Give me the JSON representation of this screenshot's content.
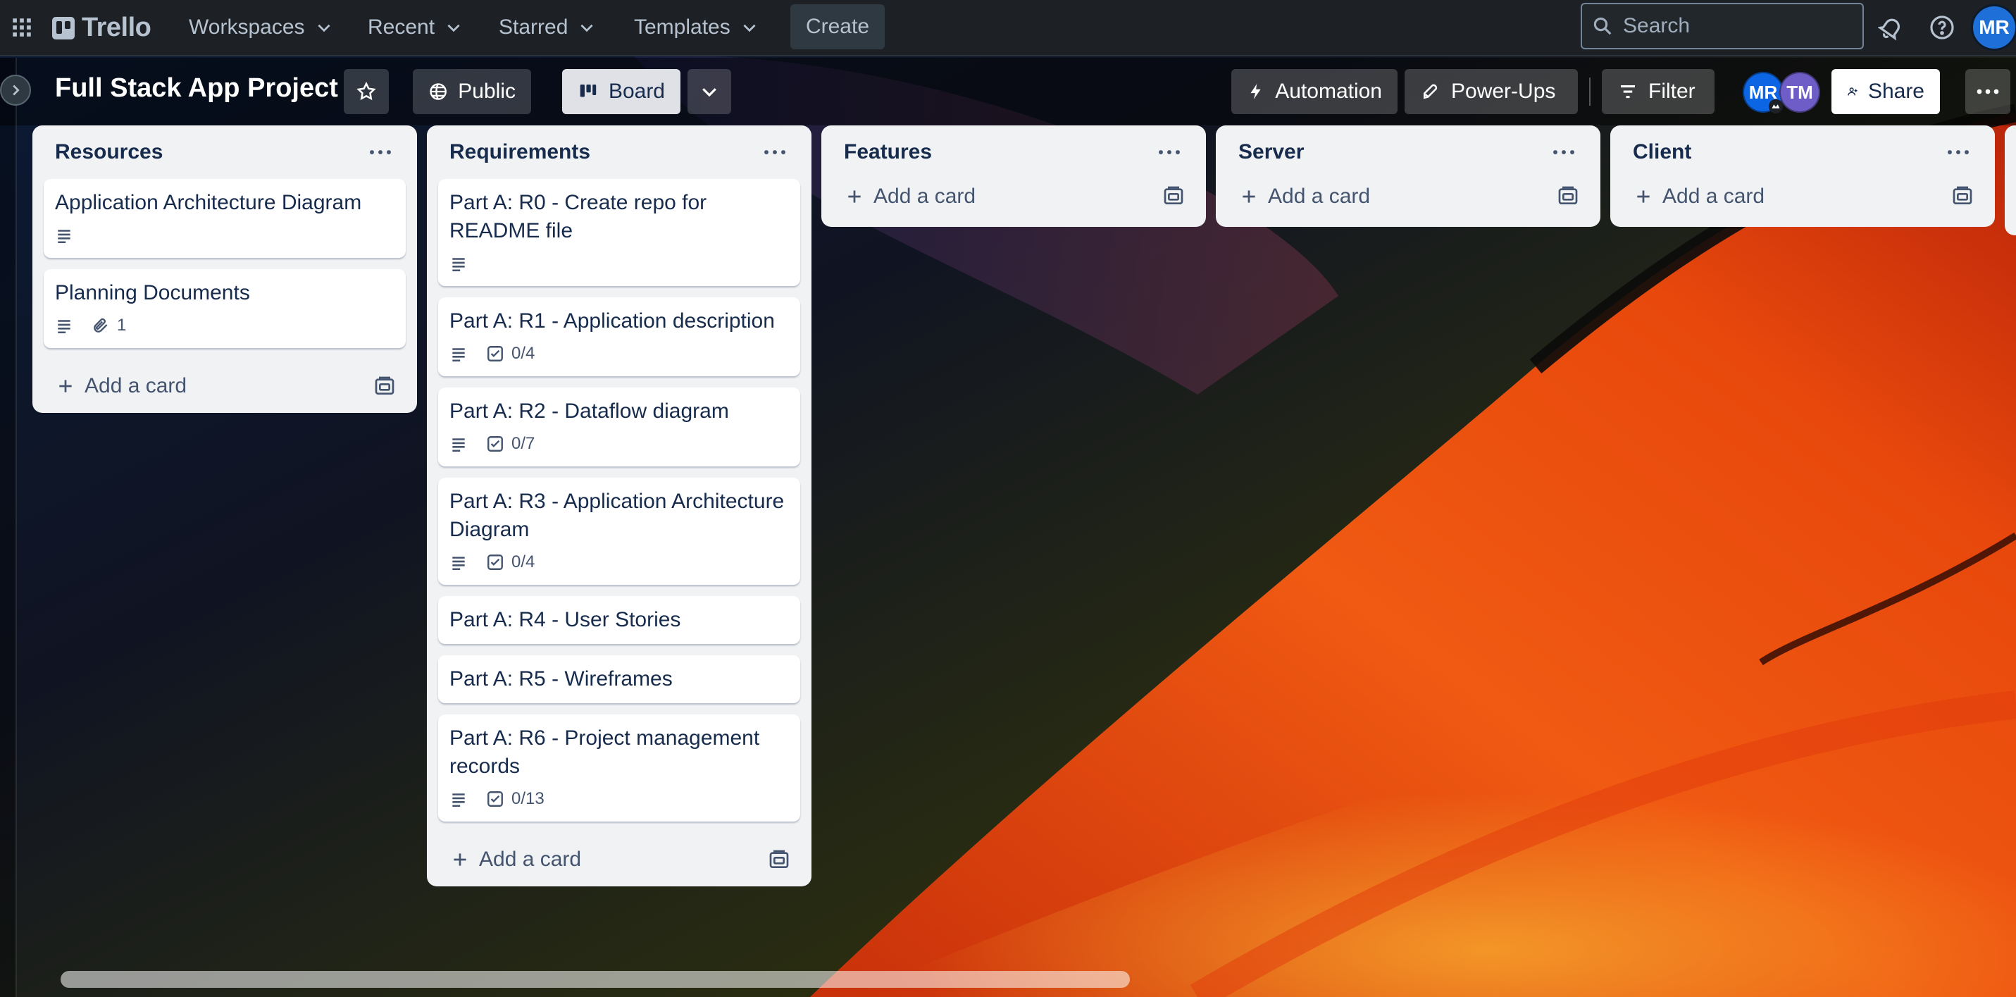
{
  "nav": {
    "brand": "Trello",
    "menus": [
      {
        "label": "Workspaces"
      },
      {
        "label": "Recent"
      },
      {
        "label": "Starred"
      },
      {
        "label": "Templates"
      }
    ],
    "create_label": "Create",
    "search_placeholder": "Search",
    "user_initials": "MR"
  },
  "board": {
    "title": "Full Stack App Project",
    "visibility_label": "Public",
    "view_label": "Board",
    "automation_label": "Automation",
    "powerups_label": "Power-Ups",
    "filter_label": "Filter",
    "members": [
      "MR",
      "TM"
    ],
    "share_label": "Share"
  },
  "lists": [
    {
      "title": "Resources",
      "cards": [
        {
          "title": "Application Architecture Diagram",
          "description": true
        },
        {
          "title": "Planning Documents",
          "description": true,
          "attachments": "1"
        }
      ],
      "add_label": "Add a card"
    },
    {
      "title": "Requirements",
      "cards": [
        {
          "title": "Part A: R0 - Create repo for README file",
          "description": true
        },
        {
          "title": "Part A: R1 - Application description",
          "description": true,
          "checklist": "0/4"
        },
        {
          "title": "Part A: R2 - Dataflow diagram",
          "description": true,
          "checklist": "0/7"
        },
        {
          "title": "Part A: R3 - Application Architecture Diagram",
          "description": true,
          "checklist": "0/4"
        },
        {
          "title": "Part A: R4 - User Stories"
        },
        {
          "title": "Part A: R5 - Wireframes"
        },
        {
          "title": "Part A: R6 - Project management records",
          "description": true,
          "checklist": "0/13"
        }
      ],
      "add_label": "Add a card"
    },
    {
      "title": "Features",
      "cards": [],
      "add_label": "Add a card"
    },
    {
      "title": "Server",
      "cards": [],
      "add_label": "Add a card"
    },
    {
      "title": "Client",
      "cards": [],
      "add_label": "Add a card"
    }
  ],
  "colors": {
    "nav_bg": "#1d2125",
    "list_bg": "#f1f2f4",
    "card_bg": "#ffffff",
    "avatar_mr": "#0c66e4",
    "avatar_tm": "#6e5dc6"
  },
  "icons": [
    "apps-grid-icon",
    "trello-logo-icon",
    "chevron-down-icon",
    "search-icon",
    "bell-icon",
    "help-icon",
    "chevron-right-icon",
    "star-icon",
    "globe-icon",
    "board-icon",
    "lightning-icon",
    "rocket-icon",
    "filter-icon",
    "add-person-icon",
    "more-icon",
    "description-icon",
    "checklist-icon",
    "attachment-icon",
    "plus-icon",
    "template-icon"
  ]
}
